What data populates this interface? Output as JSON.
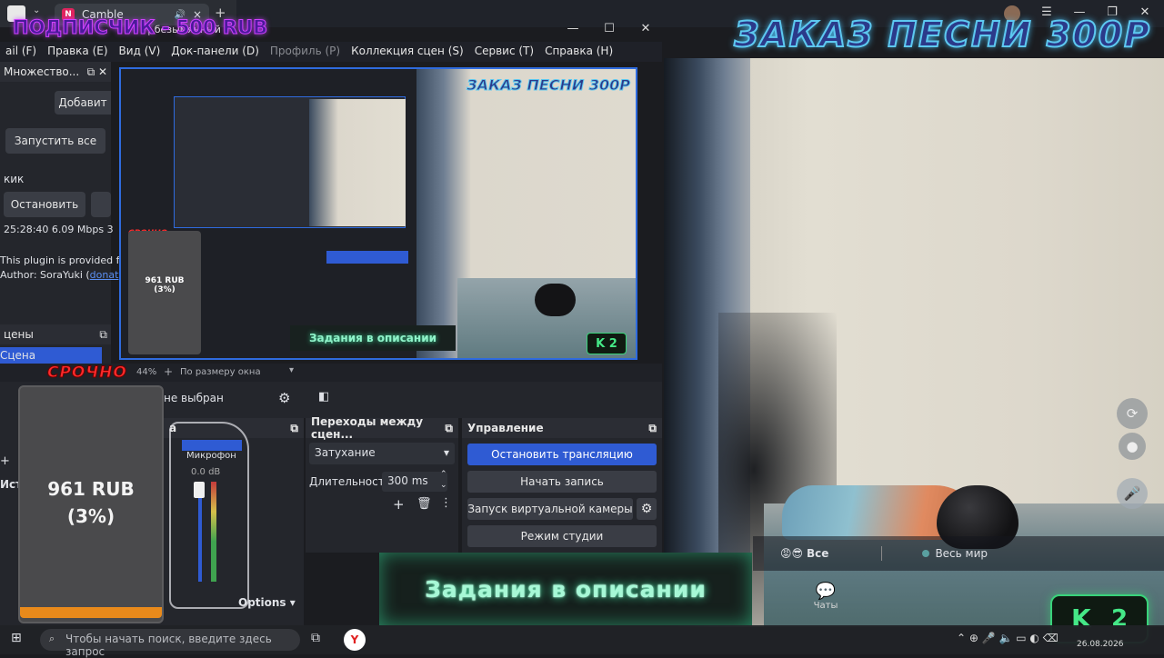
{
  "overlay": {
    "order_song": "ЗАКАЗ ПЕСНИ 300Р",
    "subscriber": "ПОДПИСЧИК - 500 RUB",
    "urgent": "СРОЧНО",
    "donation_amount": "961 RUB",
    "donation_percent": "(3%)",
    "donation_progress": 0.03,
    "tasks": "Задания в описании",
    "counter_value": "2"
  },
  "browser": {
    "tab_title": "Camble",
    "window_title": "безымянный"
  },
  "obs": {
    "menu": [
      "Правка (E)",
      "Вид (V)",
      "Док-панели (D)",
      "Профиль (P)",
      "Коллекция сцен (S)",
      "Сервис (T)",
      "Справка (H)"
    ],
    "menu_first": "ail (F)",
    "disabled_menu": "Профиль (P)"
  },
  "left_dock": {
    "header": "Множество...",
    "add_button": "Добавит",
    "start_all_button": "Запустить все",
    "kick_label": "кик",
    "stop_button": "Остановить",
    "stats": "25:28:40  6.09 Mbps  3",
    "plugin_text": "This plugin is provided f",
    "author_prefix": "Author: SoraYuki (",
    "author_link": "donat"
  },
  "scenes": {
    "header": "цены",
    "active_scene": "Сцена"
  },
  "status_strip": {
    "zoom": "44%",
    "fit_label": "По размеру окна"
  },
  "source_toolbar": {
    "no_source": "не выбран"
  },
  "mixer": {
    "header": "а",
    "channel": "Микрофон",
    "db": "0.0 dB"
  },
  "transitions": {
    "header": "Переходы между сцен...",
    "transition_value": "Затухание",
    "duration_label": "Длительность",
    "duration_value": "300 ms"
  },
  "controls": {
    "header": "Управление",
    "stop_stream": "Остановить трансляцию",
    "start_record": "Начать запись",
    "virtual_cam": "Запуск виртуальной камеры",
    "studio_mode": "Режим студии"
  },
  "options_label": "Options",
  "chat": {
    "all": "Все",
    "world": "Весь мир",
    "chats": "Чаты"
  },
  "taskbar": {
    "search_placeholder": "Чтобы начать поиск, введите здесь запрос",
    "date": "26.08.2026"
  },
  "colors": {
    "accent": "#2f5bd3",
    "urgent": "#ff2b2b",
    "tasks_glow": "#3ff0a8",
    "counter": "#45e887"
  }
}
